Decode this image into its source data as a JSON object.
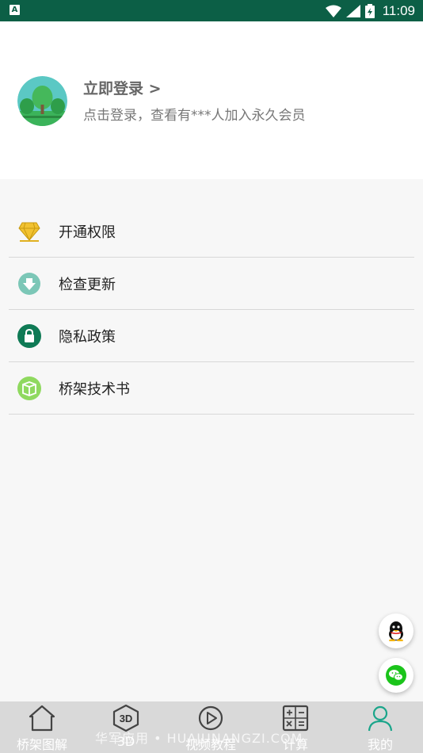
{
  "status_bar": {
    "app_icon_letter": "A",
    "time": "11:09"
  },
  "profile": {
    "title": "立即登录 >",
    "subtitle": "点击登录，查看有***人加入永久会员"
  },
  "menu": {
    "items": [
      {
        "label": "开通权限",
        "icon": "diamond-icon"
      },
      {
        "label": "检查更新",
        "icon": "download-icon"
      },
      {
        "label": "隐私政策",
        "icon": "lock-icon"
      },
      {
        "label": "桥架技术书",
        "icon": "book-icon"
      }
    ]
  },
  "floating": {
    "qq": "qq-icon",
    "wechat": "wechat-icon"
  },
  "tabbar": {
    "tabs": [
      {
        "label": "桥架图解",
        "icon": "house-icon"
      },
      {
        "label": "3D",
        "icon": "3d-cube-icon"
      },
      {
        "label": "视频教程",
        "icon": "play-icon"
      },
      {
        "label": "计算",
        "icon": "calculator-icon"
      },
      {
        "label": "我的",
        "icon": "person-icon"
      }
    ],
    "active_index": 4,
    "active_color": "#1aa58a"
  },
  "watermark": "华军应用 • HUAJUNANGZI.COM",
  "colors": {
    "status_bar": "#0c5f46",
    "accent": "#1aa58a"
  }
}
